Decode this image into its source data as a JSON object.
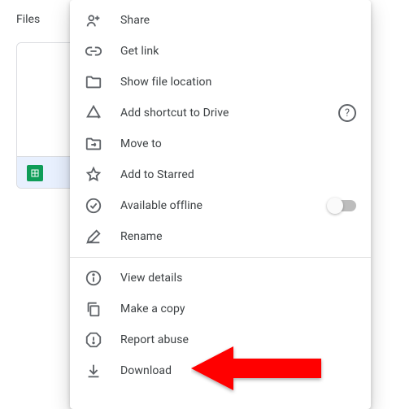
{
  "header": {
    "files_label": "Files"
  },
  "menu": {
    "share": "Share",
    "get_link": "Get link",
    "show_file_location": "Show file location",
    "add_shortcut": "Add shortcut to Drive",
    "move_to": "Move to",
    "add_to_starred": "Add to Starred",
    "available_offline": "Available offline",
    "rename": "Rename",
    "view_details": "View details",
    "make_a_copy": "Make a copy",
    "report_abuse": "Report abuse",
    "download": "Download"
  },
  "toggle": {
    "offline": false
  },
  "colors": {
    "arrow": "#ff0000",
    "sheets": "#0f9d58"
  }
}
